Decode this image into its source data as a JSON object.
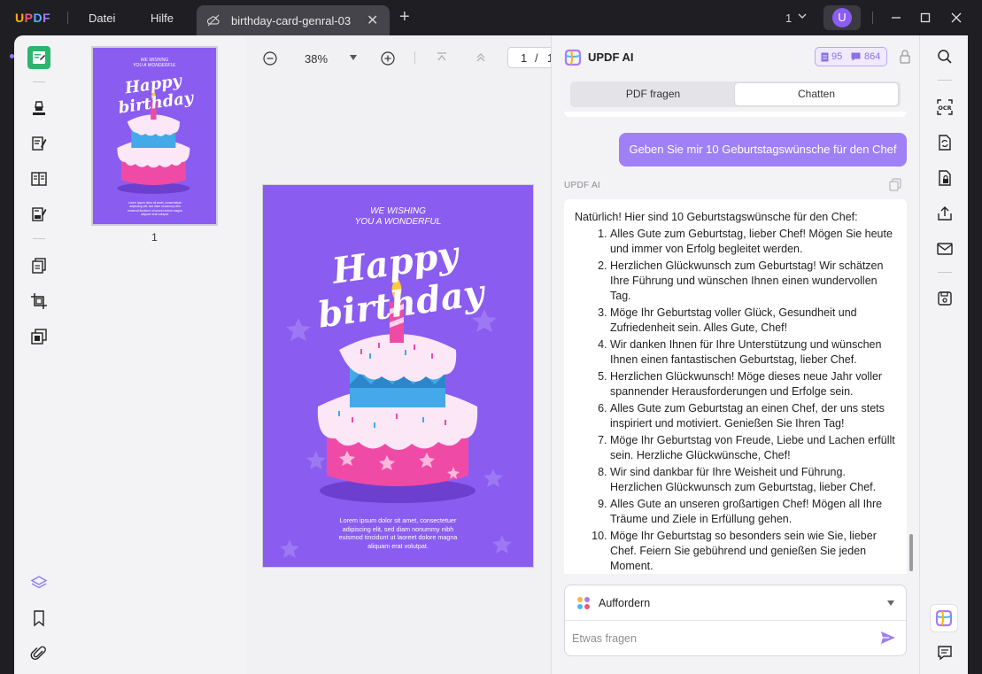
{
  "app": {
    "logo": "UPDF",
    "menu": [
      "Datei",
      "Hilfe"
    ],
    "tab_title": "birthday-card-genral-03",
    "tab_close": "✕",
    "new_tab": "+",
    "page_indicator": "1",
    "avatar_initial": "U"
  },
  "thumbnails": {
    "page_label": "1"
  },
  "document": {
    "zoom": "38%",
    "current_page": "1",
    "page_separator": "/",
    "total_pages": "1",
    "card": {
      "line1": "WE WISHING",
      "line2": "YOU A WONDERFUL",
      "title": "Happy birthday",
      "lorem": "Lorem ipsum dolor sit amet, consectetuer adipiscing elit, sed diam nonummy nibh euismod tincidunt ut laoreet dolore magna aliquam erat volutpat.",
      "background_color": "#8a5cf0"
    }
  },
  "ai_panel": {
    "title": "UPDF AI",
    "badge_docs": "95",
    "badge_chat": "864",
    "tabs": [
      "PDF fragen",
      "Chatten"
    ],
    "active_tab": "Chatten",
    "user_message": "Geben Sie mir 10 Geburtstagswünsche für den Chef",
    "ai_label": "UPDF AI",
    "answer_intro": "Natürlich! Hier sind 10 Geburtstagswünsche für den Chef:",
    "answer_items": [
      "Alles Gute zum Geburtstag, lieber Chef! Mögen Sie heute und immer von Erfolg begleitet werden.",
      "Herzlichen Glückwunsch zum Geburtstag! Wir schätzen Ihre Führung und wünschen Ihnen einen wundervollen Tag.",
      "Möge Ihr Geburtstag voller Glück, Gesundheit und Zufriedenheit sein. Alles Gute, Chef!",
      "Wir danken Ihnen für Ihre Unterstützung und wünschen Ihnen einen fantastischen Geburtstag, lieber Chef.",
      "Herzlichen Glückwunsch! Möge dieses neue Jahr voller spannender Herausforderungen und Erfolge sein.",
      "Alles Gute zum Geburtstag an einen Chef, der uns stets inspiriert und motiviert. Genießen Sie Ihren Tag!",
      "Möge Ihr Geburtstag von Freude, Liebe und Lachen erfüllt sein. Herzliche Glückwünsche, Chef!",
      "Wir sind dankbar für Ihre Weisheit und Führung. Herzlichen Glückwunsch zum Geburtstag, lieber Chef.",
      "Alles Gute an unseren großartigen Chef! Mögen all Ihre Träume und Ziele in Erfüllung gehen.",
      "Möge Ihr Geburtstag so besonders sein wie Sie, lieber Chef. Feiern Sie gebührend und genießen Sie jeden Moment."
    ],
    "prompt_label": "Auffordern",
    "input_placeholder": "Etwas fragen"
  },
  "colors": {
    "accent_purple": "#9f80f6",
    "active_green": "#2fb46e"
  }
}
